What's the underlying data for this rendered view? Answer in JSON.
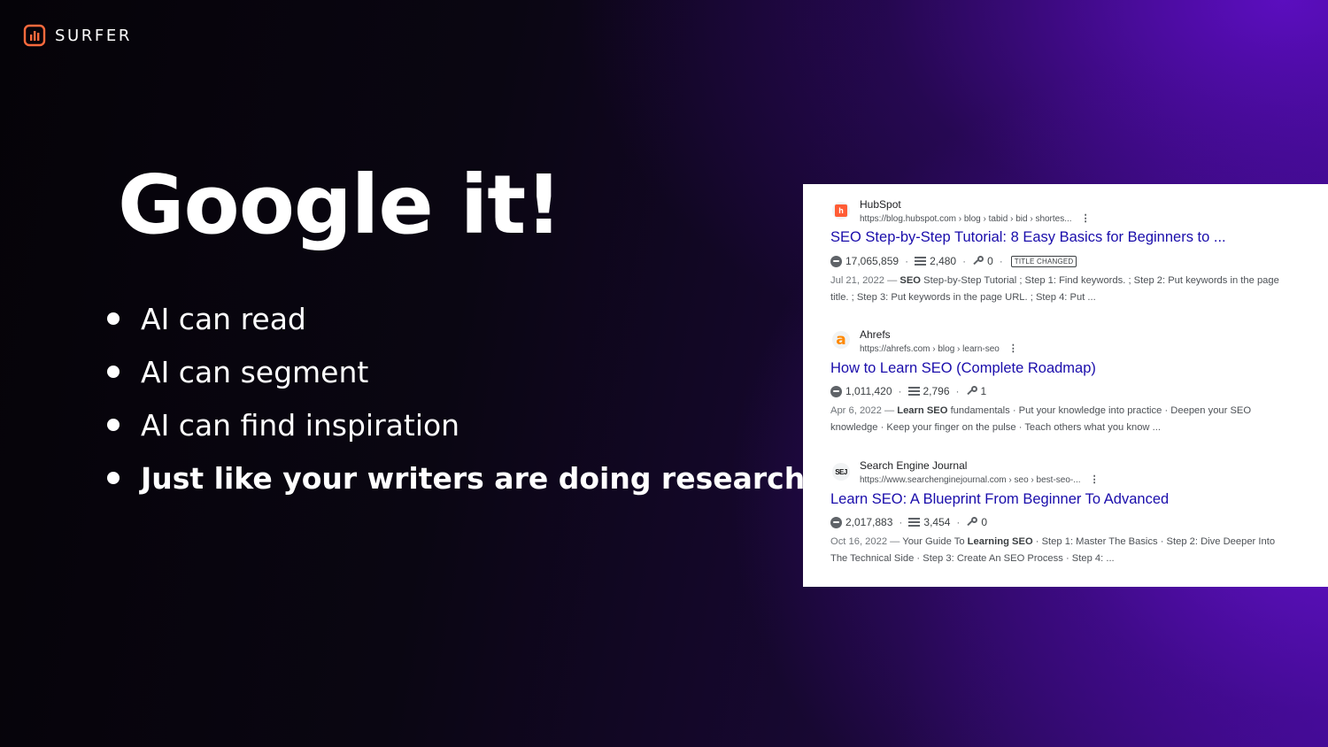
{
  "brand": {
    "name": "SURFER",
    "color": "#ff6a3d"
  },
  "slide": {
    "title": "Google it!",
    "bullets": [
      "AI can read",
      "AI can segment",
      "AI can find inspiration",
      "Just like your writers are doing research"
    ]
  },
  "serp": {
    "results": [
      {
        "site": "HubSpot",
        "url": "https://blog.hubspot.com › blog › tabid › bid › shortes...",
        "title": "SEO Step-by-Step Tutorial: 8 Easy Basics for Beginners to ...",
        "traffic": "17,065,859",
        "words": "2,480",
        "keywords": "0",
        "badge": "TITLE CHANGED",
        "date": "Jul 21, 2022 —",
        "snippet_bold": "SEO",
        "snippet_rest": "Step-by-Step Tutorial ; Step 1: Find keywords. ; Step 2: Put keywords in the page title. ; Step 3: Put keywords in the page URL. ; Step 4: Put ...",
        "favicon": "hubspot-icon"
      },
      {
        "site": "Ahrefs",
        "url": "https://ahrefs.com › blog › learn-seo",
        "title": "How to Learn SEO (Complete Roadmap)",
        "traffic": "1,011,420",
        "words": "2,796",
        "keywords": "1",
        "date": "Apr 6, 2022 —",
        "snippet_bold": "Learn SEO",
        "snippet_rest": "fundamentals · Put your knowledge into practice · Deepen your SEO knowledge · Keep your finger on the pulse · Teach others what you know ...",
        "favicon": "ahrefs-icon"
      },
      {
        "site": "Search Engine Journal",
        "url": "https://www.searchenginejournal.com › seo › best-seo-...",
        "title": "Learn SEO: A Blueprint From Beginner To Advanced",
        "traffic": "2,017,883",
        "words": "3,454",
        "keywords": "0",
        "date": "Oct 16, 2022 —",
        "snippet_pre": "Your Guide To",
        "snippet_bold": "Learning SEO",
        "snippet_rest": "· Step 1: Master The Basics · Step 2: Dive Deeper Into The Technical Side · Step 3: Create An SEO Process · Step 4: ...",
        "favicon": "sej-icon"
      }
    ],
    "favicon_letters": {
      "hubspot": "h",
      "ahrefs": "a",
      "sej": "SEJ"
    },
    "colors": {
      "link": "#1a0dab",
      "hubspot": "#ff5c35",
      "ahrefs": "#ff8800"
    }
  }
}
